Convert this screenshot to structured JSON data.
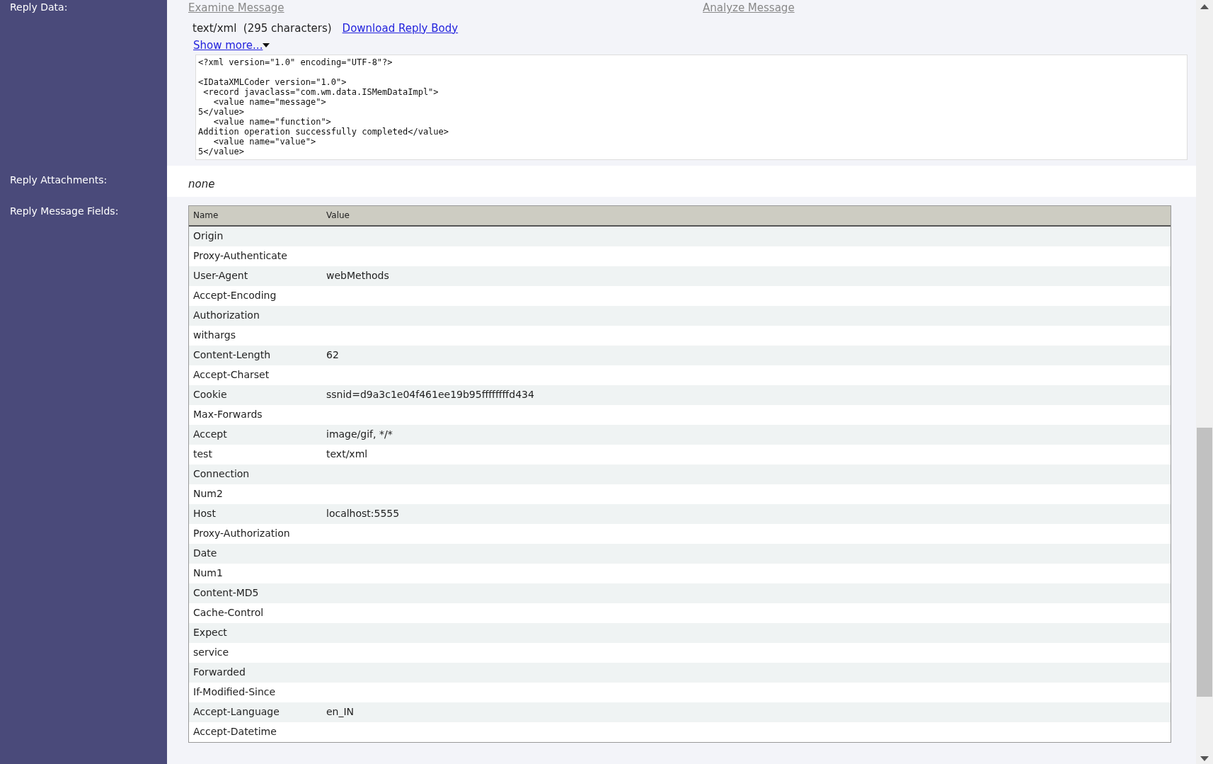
{
  "reply_data": {
    "label": "Reply Data:",
    "links": [
      {
        "text": "Examine Message"
      },
      {
        "text": "Analyze Message"
      }
    ],
    "content_type": "text/xml  (295 characters)",
    "download_link": "Download Reply Body",
    "show_more": "Show more...",
    "code": "<?xml version=\"1.0\" encoding=\"UTF-8\"?>\n\n<IDataXMLCoder version=\"1.0\">\n <record javaclass=\"com.wm.data.ISMemDataImpl\">\n   <value name=\"message\">\n5</value>\n   <value name=\"function\">\nAddition operation successfully completed</value>\n   <value name=\"value\">\n5</value>"
  },
  "attachments": {
    "label": "Reply Attachments:",
    "value": "none"
  },
  "fields": {
    "label": "Reply Message Fields:",
    "columns": [
      "Name",
      "Value"
    ],
    "rows": [
      {
        "name": "Origin"
      },
      {
        "name": "Proxy-Authenticate"
      },
      {
        "name": "User-Agent",
        "value": "webMethods"
      },
      {
        "name": "Accept-Encoding"
      },
      {
        "name": "Authorization"
      },
      {
        "name": "withargs"
      },
      {
        "name": "Content-Length",
        "value": "62"
      },
      {
        "name": "Accept-Charset"
      },
      {
        "name": "Cookie",
        "value": "ssnid=d9a3c1e04f461ee19b95ffffffffd434"
      },
      {
        "name": "Max-Forwards"
      },
      {
        "name": "Accept",
        "value": "image/gif, */*"
      },
      {
        "name": "test",
        "value": "text/xml"
      },
      {
        "name": "Connection"
      },
      {
        "name": "Num2"
      },
      {
        "name": "Host",
        "value": "localhost:5555"
      },
      {
        "name": "Proxy-Authorization"
      },
      {
        "name": "Date"
      },
      {
        "name": "Num1"
      },
      {
        "name": "Content-MD5"
      },
      {
        "name": "Cache-Control"
      },
      {
        "name": "Expect"
      },
      {
        "name": "service"
      },
      {
        "name": "Forwarded"
      },
      {
        "name": "If-Modified-Since"
      },
      {
        "name": "Accept-Language",
        "value": "en_IN"
      },
      {
        "name": "Accept-Datetime"
      }
    ]
  }
}
